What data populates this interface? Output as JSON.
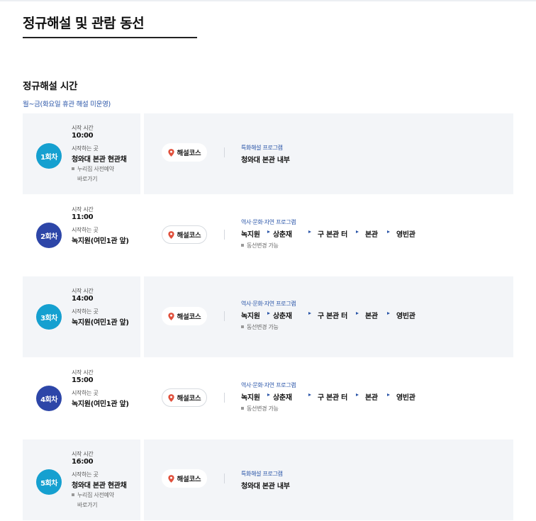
{
  "page": {
    "title": "정규해설 및 관람 동선"
  },
  "section": {
    "title": "정규해설 시간",
    "note": "월~금(화요일 휴관 해설 미운영)"
  },
  "labels": {
    "start_time": "시작 시간",
    "start_place": "시작하는 곳",
    "course_button": "해설코스"
  },
  "colors": {
    "badge_teal": "#15a0d0",
    "badge_navy": "#2d46a8",
    "accent_blue": "#2a55a8",
    "pin_red": "#e0503c",
    "row_bg": "#f3f5f8"
  },
  "sessions": [
    {
      "badge": "1회차",
      "badge_color": "teal",
      "time": "10:00",
      "place": "청와대 본관 현관채",
      "reservation_note": "누리집 사전예약",
      "reservation_link": "바로가기",
      "program_label": "특화해설 프로그램",
      "program_title": "청와대 본관 내부"
    },
    {
      "badge": "2회차",
      "badge_color": "navy",
      "time": "11:00",
      "place": "녹지원(여민1관 앞)",
      "program_label": "역사·문화·자연 프로그램",
      "route": [
        "녹지원",
        "상춘재",
        "구 본관 터",
        "본관",
        "영빈관"
      ],
      "route_note": "동선변경 가능"
    },
    {
      "badge": "3회차",
      "badge_color": "teal",
      "time": "14:00",
      "place": "녹지원(여민1관 앞)",
      "program_label": "역사·문화·자연 프로그램",
      "route": [
        "녹지원",
        "상춘재",
        "구 본관 터",
        "본관",
        "영빈관"
      ],
      "route_note": "동선변경 가능"
    },
    {
      "badge": "4회차",
      "badge_color": "navy",
      "time": "15:00",
      "place": "녹지원(여민1관 앞)",
      "program_label": "역사·문화·자연 프로그램",
      "route": [
        "녹지원",
        "상춘재",
        "구 본관 터",
        "본관",
        "영빈관"
      ],
      "route_note": "동선변경 가능"
    },
    {
      "badge": "5회차",
      "badge_color": "teal",
      "time": "16:00",
      "place": "청와대 본관 현관채",
      "reservation_note": "누리집 사전예약",
      "reservation_link": "바로가기",
      "program_label": "특화해설 프로그램",
      "program_title": "청와대 본관 내부"
    }
  ]
}
